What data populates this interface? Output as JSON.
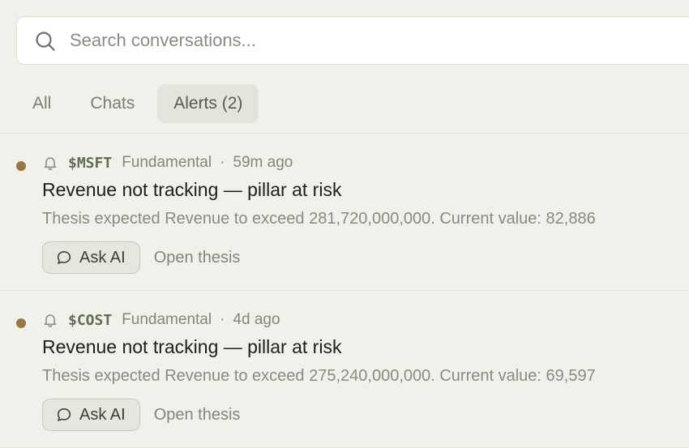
{
  "search": {
    "placeholder": "Search conversations..."
  },
  "tabs": [
    {
      "label": "All",
      "active": false
    },
    {
      "label": "Chats",
      "active": false
    },
    {
      "label": "Alerts (2)",
      "active": true
    }
  ],
  "alerts": [
    {
      "ticker": "$MSFT",
      "category": "Fundamental",
      "separator": "·",
      "time": "59m ago",
      "title": "Revenue not tracking — pillar at risk",
      "description": "Thesis expected Revenue to exceed 281,720,000,000. Current value: 82,886",
      "ask_label": "Ask AI",
      "open_label": "Open thesis"
    },
    {
      "ticker": "$COST",
      "category": "Fundamental",
      "separator": "·",
      "time": "4d ago",
      "title": "Revenue not tracking — pillar at risk",
      "description": "Thesis expected Revenue to exceed 275,240,000,000. Current value: 69,597",
      "ask_label": "Ask AI",
      "open_label": "Open thesis"
    }
  ],
  "colors": {
    "unread_dot": "#9a7746",
    "ticker": "#5f6d50",
    "background": "#f1f1ec"
  },
  "icons": {
    "search": "search-icon",
    "bell": "bell-icon",
    "chat": "chat-bubble-icon"
  }
}
